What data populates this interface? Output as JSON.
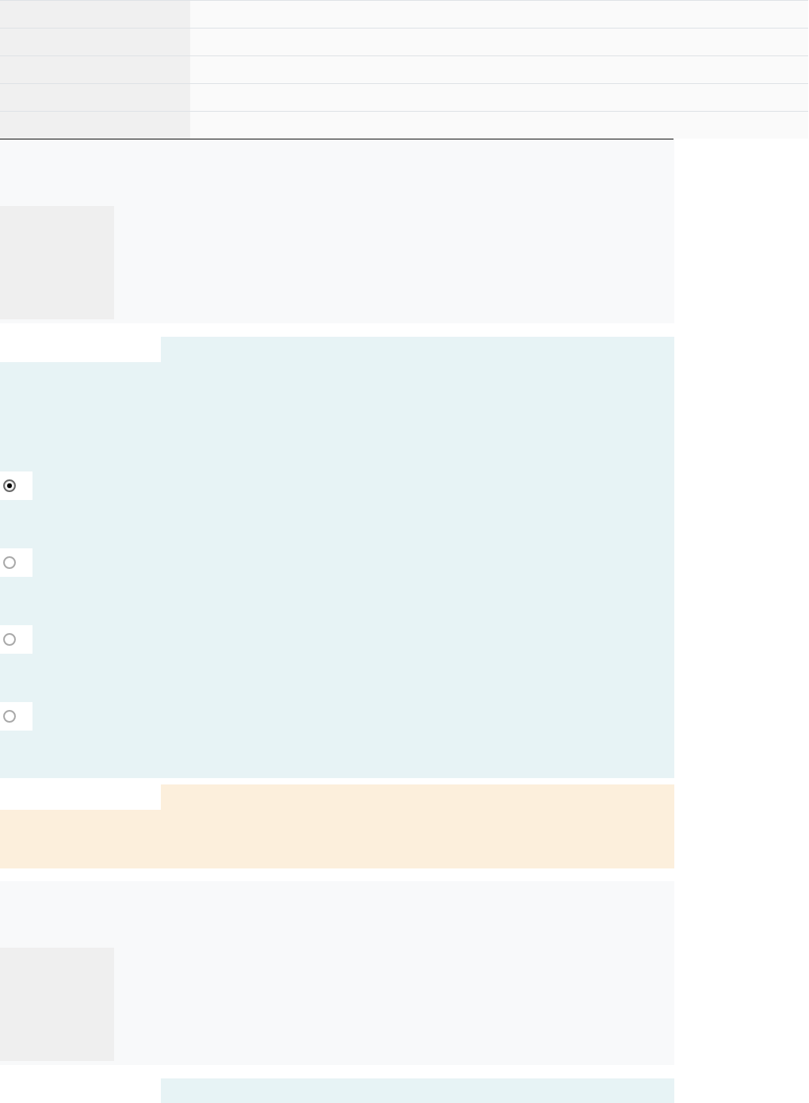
{
  "blocks": [
    {
      "kind": "info"
    },
    {
      "kind": "formulation",
      "options": [
        {
          "selected": true
        },
        {
          "selected": false
        },
        {
          "selected": false
        },
        {
          "selected": false
        }
      ]
    },
    {
      "kind": "feedback"
    },
    {
      "kind": "info"
    },
    {
      "kind": "formulation"
    }
  ]
}
